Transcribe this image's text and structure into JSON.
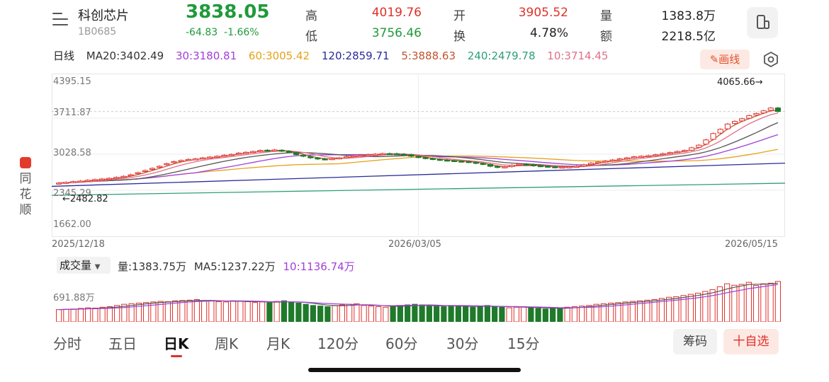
{
  "header": {
    "menu_icon": "menu-list-icon",
    "name": "科创芯片",
    "code": "1B0685",
    "price": "3838.05",
    "change": "-64.83",
    "change_pct": "-1.66%",
    "stats": [
      {
        "label": "高",
        "value": "4019.76",
        "color": "red"
      },
      {
        "label": "开",
        "value": "3905.52",
        "color": "red"
      },
      {
        "label": "量",
        "value": "1383.8万",
        "color": "dark"
      },
      {
        "label": "低",
        "value": "3756.46",
        "color": "green"
      },
      {
        "label": "换",
        "value": "4.78%",
        "color": "dark"
      },
      {
        "label": "额",
        "value": "2218.5亿",
        "color": "dark"
      }
    ],
    "phone_icon": "phone-icon"
  },
  "ma_row": {
    "period": "日线",
    "items": [
      {
        "text": "MA20:3402.49",
        "color": "#333333"
      },
      {
        "text": "30:3180.81",
        "color": "#a23fd8"
      },
      {
        "text": "60:3005.42",
        "color": "#e6a21a"
      },
      {
        "text": "120:2859.71",
        "color": "#2a2a9a"
      },
      {
        "text": "5:3888.63",
        "color": "#c0552e"
      },
      {
        "text": "240:2479.78",
        "color": "#2e9f77"
      },
      {
        "text": "10:3714.45",
        "color": "#e0708a"
      }
    ],
    "draw_button": "画线",
    "settings_icon": "settings-icon"
  },
  "price_axis": [
    "4395.15",
    "3711.87",
    "3028.58",
    "2345.29",
    "1662.00"
  ],
  "annotations": {
    "high": "4065.66→",
    "low": "←2482.82"
  },
  "dates": [
    "2025/12/18",
    "2026/03/05",
    "2026/05/15"
  ],
  "brand": {
    "chars": [
      "同",
      "花",
      "顺"
    ]
  },
  "volume": {
    "select": "成交量",
    "items": [
      {
        "text": "量:1383.75万",
        "color": "#333333"
      },
      {
        "text": "MA5:1237.22万",
        "color": "#333333"
      },
      {
        "text": "10:1136.74万",
        "color": "#a23fd8"
      }
    ],
    "axis_label": "691.88万"
  },
  "tabs": [
    "分时",
    "五日",
    "日K",
    "周K",
    "月K",
    "120分",
    "60分",
    "30分",
    "15分"
  ],
  "active_tab": "日K",
  "buttons": {
    "chips": "筹码",
    "watchlist": "十自选"
  },
  "colors": {
    "up": "#e0302a",
    "down": "#1f7a2a",
    "accent": "#e0302a"
  },
  "chart_data": {
    "type": "candlestick",
    "y_axis_ticks": [
      4395.15,
      3711.87,
      3028.58,
      2345.29,
      1662.0
    ],
    "ylim": [
      1662.0,
      4395.15
    ],
    "x_tick_labels": [
      "2025/12/18",
      "2026/03/05",
      "2026/05/15"
    ],
    "closes": [
      2482.82,
      2495,
      2510,
      2520,
      2535,
      2548,
      2560,
      2572,
      2590,
      2610,
      2640,
      2680,
      2720,
      2760,
      2800,
      2850,
      2890,
      2910,
      2930,
      2940,
      2960,
      2975,
      2990,
      3010,
      3025,
      3050,
      3065,
      3080,
      3100,
      3095,
      3110,
      3090,
      3070,
      3020,
      2990,
      2960,
      2940,
      2935,
      2945,
      2960,
      2980,
      3000,
      3010,
      3020,
      3030,
      3040,
      3035,
      3030,
      3025,
      2990,
      2970,
      2950,
      2935,
      2920,
      2910,
      2900,
      2895,
      2880,
      2860,
      2840,
      2800,
      2780,
      2790,
      2820,
      2840,
      2830,
      2810,
      2800,
      2790,
      2780,
      2785,
      2790,
      2800,
      2830,
      2860,
      2880,
      2900,
      2920,
      2940,
      2960,
      2980,
      2990,
      3000,
      3020,
      3040,
      3060,
      3080,
      3100,
      3150,
      3200,
      3300,
      3420,
      3500,
      3600,
      3650,
      3700,
      3760,
      3800,
      3850,
      3902.88,
      3838.05
    ],
    "opens": [
      2470,
      2485,
      2500,
      2515,
      2528,
      2540,
      2552,
      2565,
      2580,
      2600,
      2625,
      2660,
      2700,
      2740,
      2785,
      2830,
      2870,
      2895,
      2915,
      2935,
      2950,
      2968,
      2980,
      3000,
      3015,
      3035,
      3058,
      3070,
      3085,
      3105,
      3100,
      3105,
      3085,
      3060,
      3010,
      2985,
      2958,
      2940,
      2938,
      2950,
      2968,
      2990,
      3005,
      3015,
      3025,
      3035,
      3040,
      3038,
      3030,
      3020,
      2985,
      2965,
      2948,
      2932,
      2918,
      2908,
      2898,
      2890,
      2875,
      2855,
      2835,
      2798,
      2782,
      2795,
      2825,
      2842,
      2832,
      2812,
      2802,
      2792,
      2782,
      2788,
      2794,
      2805,
      2835,
      2865,
      2885,
      2905,
      2925,
      2945,
      2965,
      2985,
      2995,
      3005,
      3025,
      3045,
      3065,
      3085,
      3105,
      3160,
      3220,
      3310,
      3430,
      3510,
      3610,
      3660,
      3710,
      3770,
      3810,
      3860,
      3905.52
    ],
    "ma_series": [
      {
        "name": "MA20",
        "value": 3402.49
      },
      {
        "name": "30",
        "value": 3180.81
      },
      {
        "name": "60",
        "value": 3005.42
      },
      {
        "name": "120",
        "value": 2859.71
      },
      {
        "name": "5",
        "value": 3888.63
      },
      {
        "name": "240",
        "value": 2479.78
      },
      {
        "name": "10",
        "value": 3714.45
      }
    ],
    "volume_ma": {
      "MA5": "1237.22万",
      "10": "1136.74万"
    },
    "volume_latest": "1383.75万",
    "volumes": [
      420,
      430,
      440,
      460,
      480,
      470,
      500,
      520,
      560,
      600,
      620,
      640,
      660,
      680,
      700,
      690,
      720,
      730,
      740,
      760,
      700,
      720,
      690,
      680,
      720,
      700,
      690,
      660,
      680,
      650,
      700,
      720,
      660,
      640,
      600,
      560,
      540,
      520,
      560,
      580,
      600,
      620,
      560,
      540,
      520,
      500,
      540,
      560,
      580,
      600,
      580,
      560,
      540,
      520,
      560,
      540,
      520,
      500,
      540,
      560,
      520,
      500,
      480,
      500,
      520,
      480,
      460,
      440,
      460,
      480,
      500,
      520,
      540,
      560,
      600,
      620,
      640,
      660,
      680,
      700,
      720,
      740,
      760,
      800,
      840,
      860,
      900,
      940,
      980,
      1040,
      1100,
      1200,
      1300,
      1250,
      1280,
      1350,
      1240,
      1300,
      1320,
      1380
    ]
  }
}
